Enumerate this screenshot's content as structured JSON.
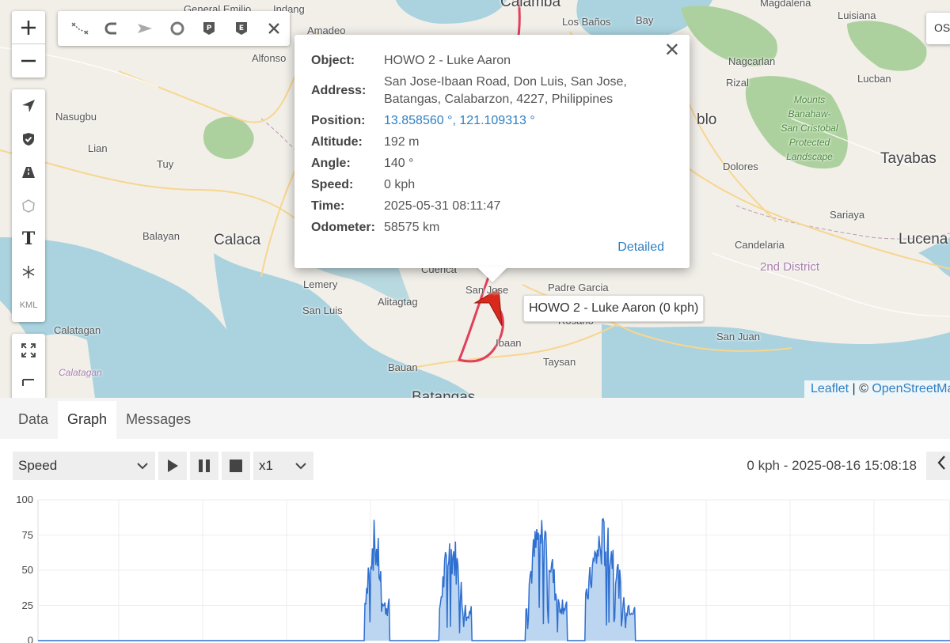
{
  "map": {
    "places": [
      {
        "name": "General Emilio",
        "cls": ""
      },
      {
        "name": "Indang",
        "cls": ""
      },
      {
        "name": "Calamba",
        "cls": "big"
      },
      {
        "name": "Los Baños",
        "cls": ""
      },
      {
        "name": "Bay",
        "cls": ""
      },
      {
        "name": "Magdalena",
        "cls": ""
      },
      {
        "name": "Luisiana",
        "cls": ""
      },
      {
        "name": "Amadeo",
        "cls": ""
      },
      {
        "name": "Alfonso",
        "cls": ""
      },
      {
        "name": "Nagcarlan",
        "cls": ""
      },
      {
        "name": "Rizal",
        "cls": ""
      },
      {
        "name": "Lucban",
        "cls": ""
      },
      {
        "name": "Nasugbu",
        "cls": ""
      },
      {
        "name": "Lian",
        "cls": ""
      },
      {
        "name": "Tuy",
        "cls": ""
      },
      {
        "name": "blo",
        "cls": "big"
      },
      {
        "name": "Dolores",
        "cls": ""
      },
      {
        "name": "Tayabas",
        "cls": "big"
      },
      {
        "name": "Balayan",
        "cls": ""
      },
      {
        "name": "Calaca",
        "cls": "big"
      },
      {
        "name": "Sariaya",
        "cls": ""
      },
      {
        "name": "Candelaria",
        "cls": ""
      },
      {
        "name": "Lucena",
        "cls": "big"
      },
      {
        "name": "Cuenca",
        "cls": ""
      },
      {
        "name": "San Jose",
        "cls": ""
      },
      {
        "name": "Padre Garcia",
        "cls": ""
      },
      {
        "name": "Lemery",
        "cls": ""
      },
      {
        "name": "San Luis",
        "cls": ""
      },
      {
        "name": "Alitagtag",
        "cls": ""
      },
      {
        "name": "2nd District",
        "cls": "district"
      },
      {
        "name": "Ibaan",
        "cls": ""
      },
      {
        "name": "Rosario",
        "cls": ""
      },
      {
        "name": "Calatagan",
        "cls": ""
      },
      {
        "name": "San Juan",
        "cls": ""
      },
      {
        "name": "Taysan",
        "cls": ""
      },
      {
        "name": "Bauan",
        "cls": ""
      },
      {
        "name": "Calatagan",
        "cls": "cal"
      },
      {
        "name": "Batangas",
        "cls": "big"
      }
    ],
    "park_label": "Mounts Banahaw-San Cristobal Protected Landscape",
    "park_lines": [
      "Mounts",
      "Banahaw-",
      "San Cristobal",
      "Protected",
      "Landscape"
    ],
    "layer_button_label": "OS",
    "tooltip": "HOWO 2 - Luke Aaron (0 kph)",
    "attribution": {
      "leaflet": "Leaflet",
      "sep": " | © ",
      "osm": "OpenStreetMap"
    },
    "kml_label": "KML",
    "text_tool_label": "T",
    "marker_color": "#d9291a",
    "route_color": "#e0405a"
  },
  "popup": {
    "rows": [
      {
        "label": "Object:",
        "value": "HOWO 2 - Luke Aaron"
      },
      {
        "label": "Address:",
        "value": "San Jose-Ibaan Road, Don Luis, San Jose, Batangas, Calabarzon, 4227, Philippines"
      },
      {
        "label": "Position:",
        "value": "13.858560 °, 121.109313 °"
      },
      {
        "label": "Altitude:",
        "value": "192 m"
      },
      {
        "label": "Angle:",
        "value": "140 °"
      },
      {
        "label": "Speed:",
        "value": "0 kph"
      },
      {
        "label": "Time:",
        "value": "2025-05-31 08:11:47"
      },
      {
        "label": "Odometer:",
        "value": "58575 km"
      }
    ],
    "detail_link": "Detailed",
    "close_glyph": "✕"
  },
  "tabs": [
    {
      "label": "Data",
      "active": false
    },
    {
      "label": "Graph",
      "active": true
    },
    {
      "label": "Messages",
      "active": false
    }
  ],
  "toolbar": {
    "sensor_select": "Speed",
    "speed_select": "x1",
    "status_speed": "0 kph",
    "status_time": "- 2025-08-16 15:08:18"
  },
  "chart_data": {
    "type": "area",
    "title": "",
    "xlabel": "",
    "ylabel": "",
    "ylim": [
      0,
      100
    ],
    "yticks": [
      0,
      25,
      50,
      75,
      100
    ],
    "grid": true,
    "color": "#2f6fd0",
    "fill": "#bcd6f2",
    "bursts": [
      {
        "start": 0.358,
        "end": 0.385,
        "peak": 87
      },
      {
        "start": 0.44,
        "end": 0.475,
        "peak": 80
      },
      {
        "start": 0.535,
        "end": 0.58,
        "peak": 95
      },
      {
        "start": 0.6,
        "end": 0.655,
        "peak": 90
      }
    ]
  }
}
